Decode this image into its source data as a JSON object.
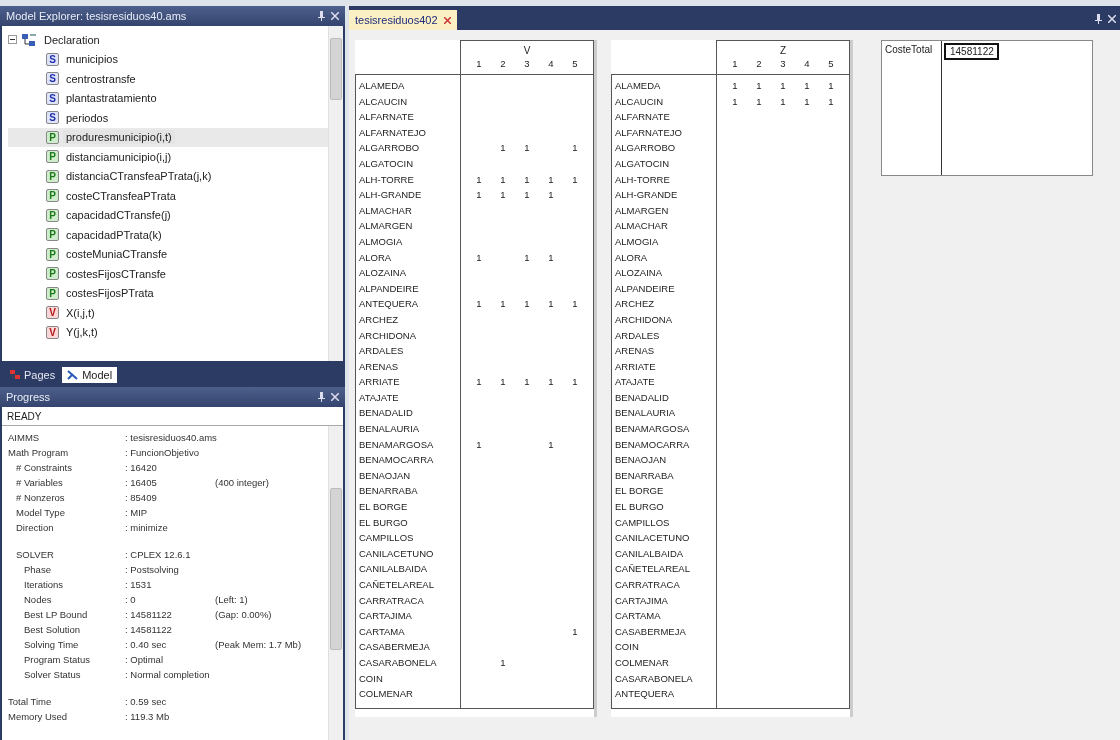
{
  "explorer": {
    "title": "Model Explorer: tesisresiduos40.ams",
    "tree": {
      "label": "Declaration",
      "expanded": true,
      "children": [
        {
          "label": "municipios",
          "kind": "set",
          "symbol": "S",
          "selected": false
        },
        {
          "label": "centrostransfe",
          "kind": "set",
          "symbol": "S",
          "selected": false
        },
        {
          "label": "plantastratamiento",
          "kind": "set",
          "symbol": "S",
          "selected": false
        },
        {
          "label": "periodos",
          "kind": "set",
          "symbol": "S",
          "selected": false
        },
        {
          "label": "produresmunicipio(i,t)",
          "kind": "parameter",
          "symbol": "P",
          "selected": true
        },
        {
          "label": "distanciamunicipio(i,j)",
          "kind": "parameter",
          "symbol": "P",
          "selected": false
        },
        {
          "label": "distanciaCTransfeaPTrata(j,k)",
          "kind": "parameter",
          "symbol": "P",
          "selected": false
        },
        {
          "label": "costeCTransfeaPTrata",
          "kind": "parameter",
          "symbol": "P",
          "selected": false
        },
        {
          "label": "capacidadCTransfe(j)",
          "kind": "parameter",
          "symbol": "P",
          "selected": false
        },
        {
          "label": "capacidadPTrata(k)",
          "kind": "parameter",
          "symbol": "P",
          "selected": false
        },
        {
          "label": "costeMuniaCTransfe",
          "kind": "parameter",
          "symbol": "P",
          "selected": false
        },
        {
          "label": "costesFijosCTransfe",
          "kind": "parameter",
          "symbol": "P",
          "selected": false
        },
        {
          "label": "costesFijosPTrata",
          "kind": "parameter",
          "symbol": "P",
          "selected": false
        },
        {
          "label": "X(i,j,t)",
          "kind": "variable",
          "symbol": "V",
          "selected": false
        },
        {
          "label": "Y(j,k,t)",
          "kind": "variable",
          "symbol": "V",
          "selected": false
        }
      ]
    },
    "tabs": [
      {
        "label": "Pages",
        "kind": "pages",
        "selected": false
      },
      {
        "label": "Model",
        "kind": "model",
        "selected": true
      }
    ]
  },
  "progress": {
    "title": "Progress",
    "status": "READY",
    "entries": [
      {
        "label": "AIMMS",
        "value": ": tesisresiduos40.ams"
      },
      {
        "label": "Math Program",
        "value": ": FuncionObjetivo",
        "children": [
          {
            "label": "# Constraints",
            "value": ": 16420"
          },
          {
            "label": "# Variables",
            "value": ": 16405",
            "note": "(400 integer)"
          },
          {
            "label": "# Nonzeros",
            "value": ": 85409"
          },
          {
            "label": "Model Type",
            "value": ": MIP"
          },
          {
            "label": "Direction",
            "value": ": minimize"
          },
          {
            "label": "SOLVER",
            "value": ": CPLEX 12.6.1",
            "gap_before": true,
            "children": [
              {
                "label": "Phase",
                "value": ": Postsolving"
              },
              {
                "label": "Iterations",
                "value": ": 1531"
              },
              {
                "label": "Nodes",
                "value": ": 0",
                "note": "(Left: 1)"
              },
              {
                "label": "Best LP Bound",
                "value": ": 14581122",
                "note": "(Gap: 0.00%)"
              },
              {
                "label": "Best Solution",
                "value": ": 14581122"
              },
              {
                "label": "Solving Time",
                "value": ": 0.40 sec",
                "note": "(Peak Mem: 1.7 Mb)"
              },
              {
                "label": "Program Status",
                "value": ": Optimal"
              },
              {
                "label": "Solver Status",
                "value": ": Normal completion"
              }
            ]
          }
        ]
      },
      {
        "label": "Total Time",
        "value": ": 0.59 sec",
        "gap_before": true
      },
      {
        "label": "Memory Used",
        "value": ": 119.3 Mb"
      }
    ]
  },
  "document_tabs": [
    {
      "label": "tesisresiduos402",
      "selected": true
    }
  ],
  "tables": [
    {
      "identifier": "V",
      "columns": [
        "1",
        "2",
        "3",
        "4",
        "5"
      ],
      "rows": [
        {
          "name": "ALAMEDA"
        },
        {
          "name": "ALCAUCIN"
        },
        {
          "name": "ALFARNATE"
        },
        {
          "name": "ALFARNATEJO"
        },
        {
          "name": "ALGARROBO",
          "values": {
            "2": "1",
            "3": "1",
            "5": "1"
          }
        },
        {
          "name": "ALGATOCIN"
        },
        {
          "name": "ALH-TORRE",
          "values": {
            "1": "1",
            "2": "1",
            "3": "1",
            "4": "1",
            "5": "1"
          }
        },
        {
          "name": "ALH-GRANDE",
          "values": {
            "1": "1",
            "2": "1",
            "3": "1",
            "4": "1"
          }
        },
        {
          "name": "ALMACHAR"
        },
        {
          "name": "ALMARGEN"
        },
        {
          "name": "ALMOGIA"
        },
        {
          "name": "ALORA",
          "values": {
            "1": "1",
            "3": "1",
            "4": "1"
          }
        },
        {
          "name": "ALOZAINA"
        },
        {
          "name": "ALPANDEIRE"
        },
        {
          "name": "ANTEQUERA",
          "values": {
            "1": "1",
            "2": "1",
            "3": "1",
            "4": "1",
            "5": "1"
          }
        },
        {
          "name": "ARCHEZ"
        },
        {
          "name": "ARCHIDONA"
        },
        {
          "name": "ARDALES"
        },
        {
          "name": "ARENAS"
        },
        {
          "name": "ARRIATE",
          "values": {
            "1": "1",
            "2": "1",
            "3": "1",
            "4": "1",
            "5": "1"
          }
        },
        {
          "name": "ATAJATE"
        },
        {
          "name": "BENADALID"
        },
        {
          "name": "BENALAURIA"
        },
        {
          "name": "BENAMARGOSA",
          "values": {
            "1": "1",
            "4": "1"
          }
        },
        {
          "name": "BENAMOCARRA"
        },
        {
          "name": "BENAOJAN"
        },
        {
          "name": "BENARRABA"
        },
        {
          "name": "EL BORGE"
        },
        {
          "name": "EL BURGO"
        },
        {
          "name": "CAMPILLOS"
        },
        {
          "name": "CANILACETUNO"
        },
        {
          "name": "CANILALBAIDA"
        },
        {
          "name": "CAÑETELAREAL"
        },
        {
          "name": "CARRATRACA"
        },
        {
          "name": "CARTAJIMA"
        },
        {
          "name": "CARTAMA",
          "values": {
            "5": "1"
          }
        },
        {
          "name": "CASABERMEJA"
        },
        {
          "name": "CASARABONELA",
          "values": {
            "2": "1"
          }
        },
        {
          "name": "COIN"
        },
        {
          "name": "COLMENAR"
        }
      ]
    },
    {
      "identifier": "Z",
      "columns": [
        "1",
        "2",
        "3",
        "4",
        "5"
      ],
      "rows": [
        {
          "name": "ALAMEDA",
          "values": {
            "1": "1",
            "2": "1",
            "3": "1",
            "4": "1",
            "5": "1"
          }
        },
        {
          "name": "ALCAUCIN",
          "values": {
            "1": "1",
            "2": "1",
            "3": "1",
            "4": "1",
            "5": "1"
          }
        },
        {
          "name": "ALFARNATE"
        },
        {
          "name": "ALFARNATEJO"
        },
        {
          "name": "ALGARROBO"
        },
        {
          "name": "ALGATOCIN"
        },
        {
          "name": "ALH-TORRE"
        },
        {
          "name": "ALH-GRANDE"
        },
        {
          "name": "ALMARGEN"
        },
        {
          "name": "ALMACHAR"
        },
        {
          "name": "ALMOGIA"
        },
        {
          "name": "ALORA"
        },
        {
          "name": "ALOZAINA"
        },
        {
          "name": "ALPANDEIRE"
        },
        {
          "name": "ARCHEZ"
        },
        {
          "name": "ARCHIDONA"
        },
        {
          "name": "ARDALES"
        },
        {
          "name": "ARENAS"
        },
        {
          "name": "ARRIATE"
        },
        {
          "name": "ATAJATE"
        },
        {
          "name": "BENADALID"
        },
        {
          "name": "BENALAURIA"
        },
        {
          "name": "BENAMARGOSA"
        },
        {
          "name": "BENAMOCARRA"
        },
        {
          "name": "BENAOJAN"
        },
        {
          "name": "BENARRABA"
        },
        {
          "name": "EL BORGE"
        },
        {
          "name": "EL BURGO"
        },
        {
          "name": "CAMPILLOS"
        },
        {
          "name": "CANILACETUNO"
        },
        {
          "name": "CANILALBAIDA"
        },
        {
          "name": "CAÑETELAREAL"
        },
        {
          "name": "CARRATRACA"
        },
        {
          "name": "CARTAJIMA"
        },
        {
          "name": "CARTAMA"
        },
        {
          "name": "CASABERMEJA"
        },
        {
          "name": "COIN"
        },
        {
          "name": "COLMENAR"
        },
        {
          "name": "CASARABONELA"
        },
        {
          "name": "ANTEQUERA"
        }
      ]
    }
  ],
  "scalar": {
    "label": "CosteTotal",
    "value": "14581122"
  }
}
